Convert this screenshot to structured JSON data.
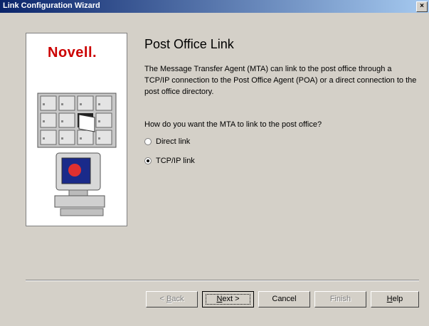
{
  "window": {
    "title": "Link Configuration Wizard",
    "close_glyph": "×"
  },
  "panel": {
    "logo_text": "Novell."
  },
  "content": {
    "heading": "Post Office Link",
    "description": "The Message Transfer Agent (MTA) can link to the post office through a TCP/IP connection to the Post Office Agent (POA) or a direct connection to the post office directory.",
    "question": "How do you want the MTA to link to the post office?",
    "options": [
      {
        "label": "Direct link",
        "selected": false
      },
      {
        "label": "TCP/IP link",
        "selected": true
      }
    ]
  },
  "buttons": {
    "back": {
      "prefix": "< ",
      "accel": "B",
      "rest": "ack",
      "enabled": false
    },
    "next": {
      "accel": "N",
      "rest": "ext >",
      "enabled": true
    },
    "cancel": {
      "label": "Cancel",
      "enabled": true
    },
    "finish": {
      "label": "Finish",
      "enabled": false
    },
    "help": {
      "accel": "H",
      "rest": "elp",
      "enabled": true
    }
  },
  "colors": {
    "titlebar_start": "#0a246a",
    "titlebar_end": "#a6caf0",
    "logo_red": "#cc0000",
    "face": "#d4d0c8"
  }
}
